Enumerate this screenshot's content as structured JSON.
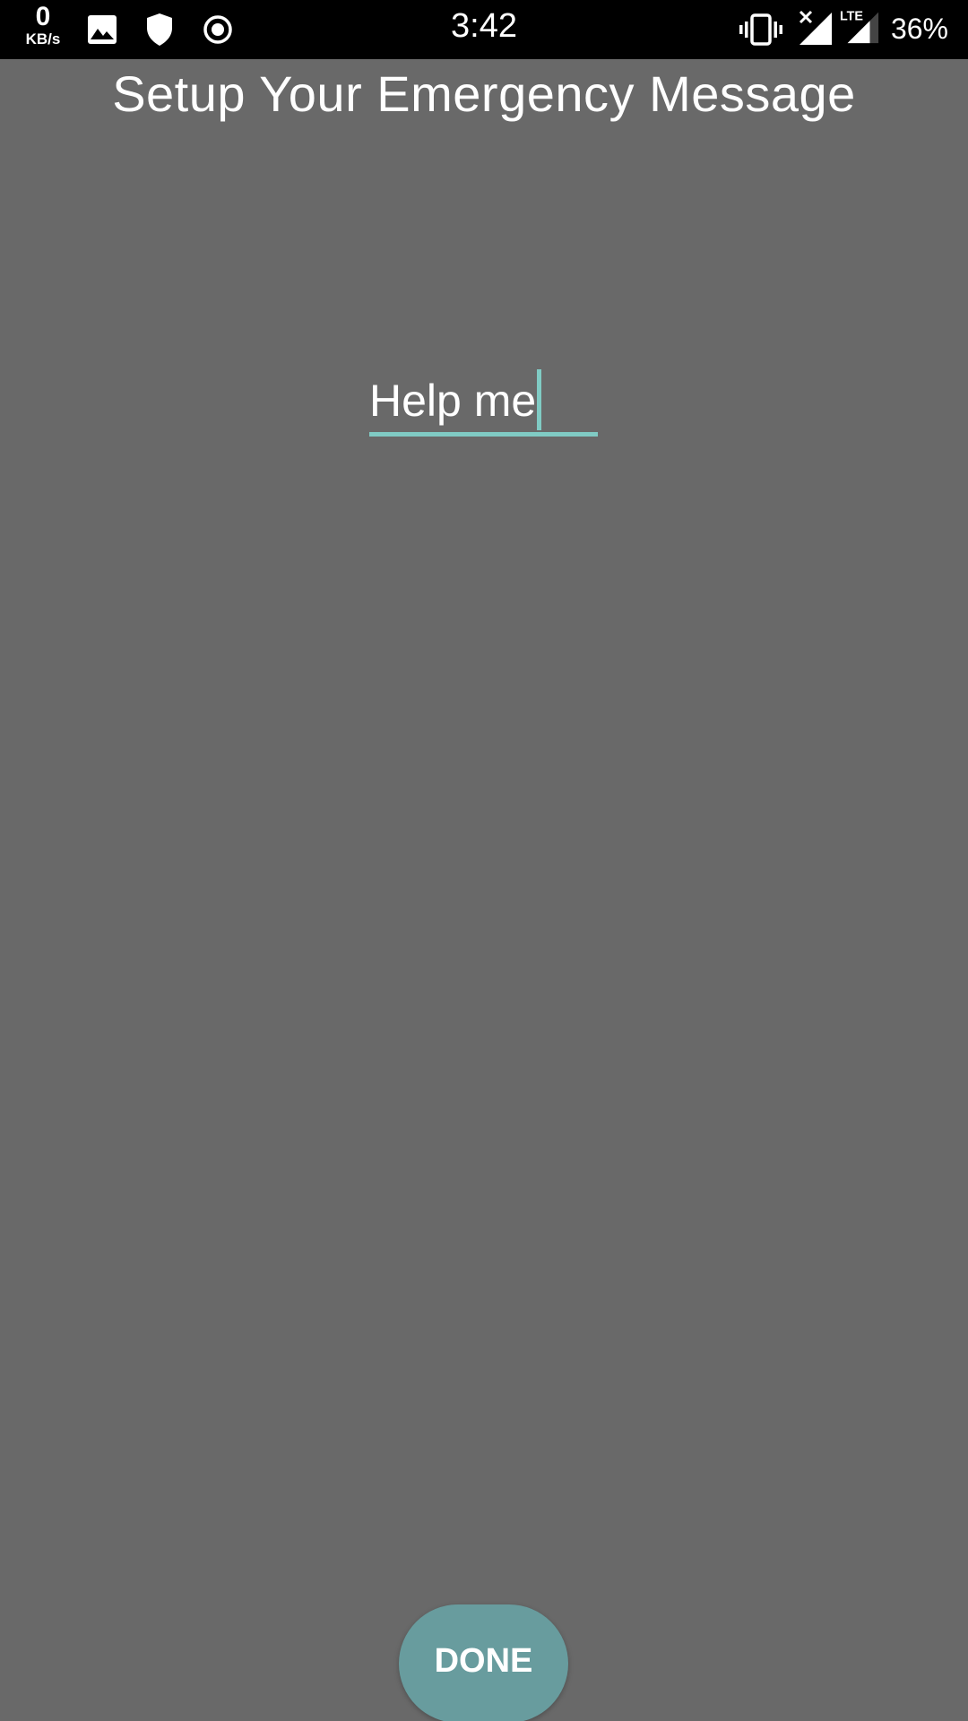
{
  "status_bar": {
    "net_speed_value": "0",
    "net_speed_unit": "KB/s",
    "time": "3:42",
    "network_type": "LTE",
    "battery": "36%",
    "icons": [
      "image-icon",
      "shield-icon",
      "record-icon",
      "vibrate-icon",
      "signal-no-service-icon",
      "signal-lte-icon"
    ]
  },
  "page": {
    "title": "Setup Your Emergency Message"
  },
  "message_input": {
    "value": "Help me"
  },
  "done_button": {
    "label": "DONE"
  },
  "colors": {
    "background": "#696969",
    "accent": "#80cbc4",
    "button": "#689c9e",
    "status_bar": "#000000"
  }
}
